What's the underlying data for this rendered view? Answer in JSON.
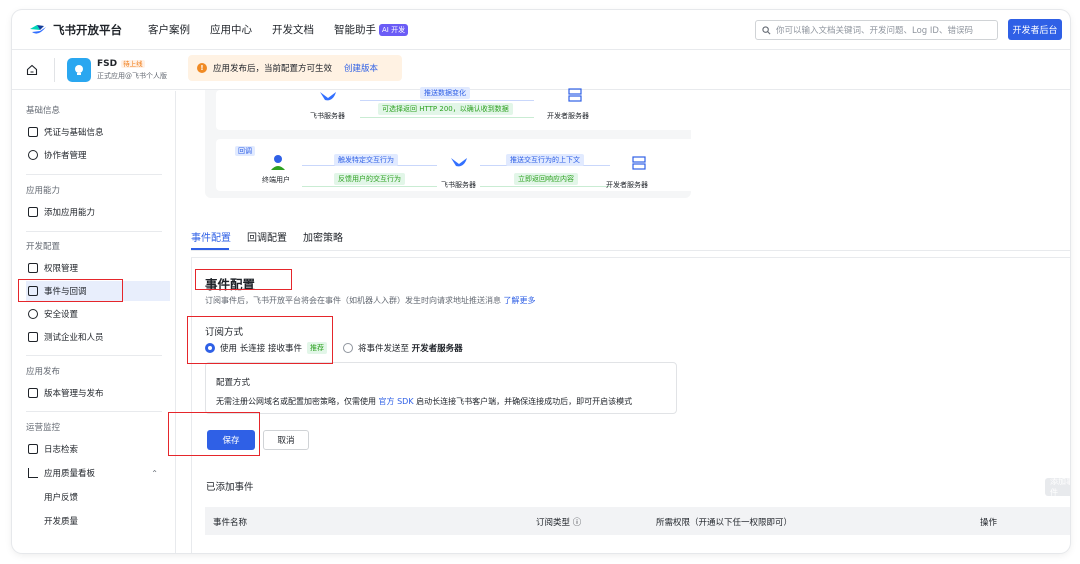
{
  "topnav": {
    "brand": "飞书开放平台",
    "items": [
      "客户案例",
      "应用中心",
      "开发文档",
      "智能助手"
    ],
    "ai_badge": "AI 开发",
    "search_placeholder": "你可以输入文档关键词、开发问题、Log ID、错误码",
    "dev_console": "开发者后台"
  },
  "app": {
    "name": "FSD",
    "status": "待上线",
    "subtitle": "正式应用@飞书个人版"
  },
  "notice": {
    "text": "应用发布后，当前配置方可生效",
    "link": "创建版本"
  },
  "sidebar": {
    "groups": [
      "基础信息",
      "应用能力",
      "开发配置",
      "应用发布",
      "运营监控"
    ],
    "items": [
      "凭证与基础信息",
      "协作者管理",
      "添加应用能力",
      "权限管理",
      "事件与回调",
      "安全设置",
      "测试企业和人员",
      "版本管理与发布",
      "日志检索",
      "应用质量看板"
    ],
    "sub_items": [
      "用户反馈",
      "开发质量"
    ],
    "active": "事件与回调"
  },
  "flow": {
    "event_row": {
      "push_label": "推送数据变化",
      "return_label": "可选择返回 HTTP 200，以确认收到数据",
      "left_node": "飞书服务器",
      "right_node": "开发者服务器"
    },
    "callback_row": {
      "tag": "回调",
      "user_node": "终端用户",
      "trigger_label": "触发特定交互行为",
      "feedback_label": "反馈用户的交互行为",
      "push_context_label": "推送交互行为的上下文",
      "return_label": "立即返回响应内容",
      "mid_node": "飞书服务器",
      "right_node": "开发者服务器"
    }
  },
  "tabs": [
    "事件配置",
    "回调配置",
    "加密策略"
  ],
  "main": {
    "title": "事件配置",
    "desc": "订阅事件后，飞书开放平台将会在事件（如机器人入群）发生时向请求地址推送消息",
    "desc_link": "了解更多",
    "subscribe_title": "订阅方式",
    "option1_prefix": "使用",
    "option1_main": "长连接",
    "option1_suffix": "接收事件",
    "recommend": "推荐",
    "option2_prefix": "将事件发送至",
    "option2_main": "开发者服务器",
    "config_title": "配置方式",
    "config_text_1": "无需注册公网域名或配置加密策略，仅需使用",
    "config_link": "官方 SDK",
    "config_text_2": "启动长连接飞书客户端，并确保连接成功后，即可开启该模式",
    "save": "保存",
    "cancel": "取消",
    "added_title": "已添加事件",
    "add_button": "添加事件",
    "table_headers": [
      "事件名称",
      "订阅类型",
      "所需权限（开通以下任一权限即可）",
      "操作"
    ]
  },
  "colors": {
    "primary": "#2f60e6",
    "highlight": "#e5262b",
    "notice_bg": "#fff2e3",
    "recommend": "#2ea121"
  }
}
